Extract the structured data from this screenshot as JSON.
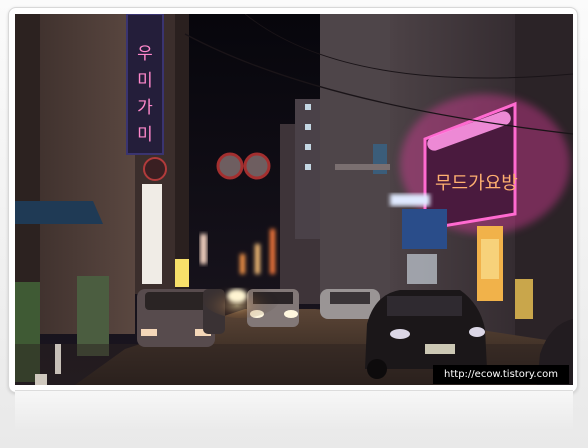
{
  "photo": {
    "sign_vertical": "우미가미",
    "sign_pink": "무드가요방",
    "watermark": "http://ecow.tistory.com"
  }
}
